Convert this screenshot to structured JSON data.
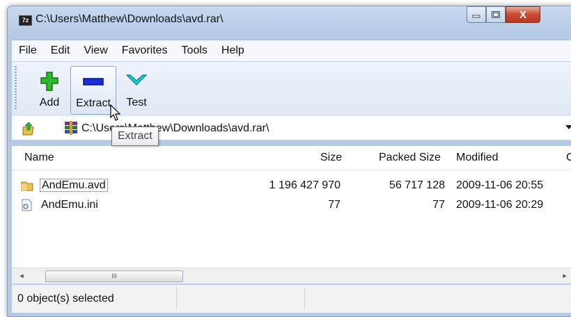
{
  "window": {
    "title": "C:\\Users\\Matthew\\Downloads\\avd.rar\\",
    "app_badge": "7z",
    "close_glyph": "X"
  },
  "menu": [
    "File",
    "Edit",
    "View",
    "Favorites",
    "Tools",
    "Help"
  ],
  "toolbar": {
    "add_label": "Add",
    "extract_label": "Extract",
    "test_label": "Test",
    "add_icon": "plus-icon",
    "extract_icon": "minus-icon",
    "test_icon": "check-icon"
  },
  "address": {
    "path": "C:\\Users\\Matthew\\Downloads\\avd.rar\\"
  },
  "tooltip": "Extract",
  "columns": {
    "name": "Name",
    "size": "Size",
    "packed": "Packed Size",
    "modified": "Modified",
    "extra": "C"
  },
  "files": [
    {
      "name": "AndEmu.avd",
      "size": "1 196 427 970",
      "packed": "56 717 128",
      "modified": "2009-11-06 20:55",
      "icon": "folder-icon"
    },
    {
      "name": "AndEmu.ini",
      "size": "77",
      "packed": "77",
      "modified": "2009-11-06 20:29",
      "icon": "ini-file-icon"
    }
  ],
  "scroll": {
    "left_glyph": "◂",
    "right_glyph": "▸",
    "thumb_glyph": "III"
  },
  "status": {
    "selection": "0 object(s) selected"
  },
  "colors": {
    "frame": "#b5cae6",
    "add_icon": "#2db82d",
    "extract_icon": "#1a2fd6",
    "test_icon": "#1fc9d4",
    "close_button": "#c84a32"
  }
}
